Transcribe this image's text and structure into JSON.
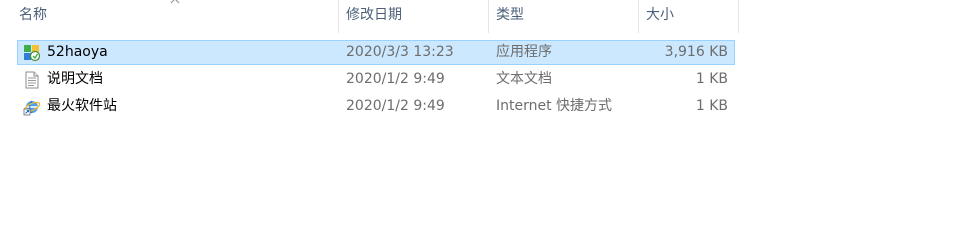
{
  "columns": {
    "name": "名称",
    "date": "修改日期",
    "type": "类型",
    "size": "大小"
  },
  "files": [
    {
      "name": "52haoya",
      "date": "2020/3/3 13:23",
      "type": "应用程序",
      "size": "3,916 KB",
      "icon": "application-icon",
      "selected": true
    },
    {
      "name": "说明文档",
      "date": "2020/1/2 9:49",
      "type": "文本文档",
      "size": "1 KB",
      "icon": "text-document-icon",
      "selected": false
    },
    {
      "name": "最火软件站",
      "date": "2020/1/2 9:49",
      "type": "Internet 快捷方式",
      "size": "1 KB",
      "icon": "internet-shortcut-icon",
      "selected": false
    }
  ],
  "colors": {
    "selection_bg": "#cce8ff",
    "selection_border": "#99d1ff",
    "header_text": "#4c607a",
    "secondary_text": "#6d6d6d"
  }
}
